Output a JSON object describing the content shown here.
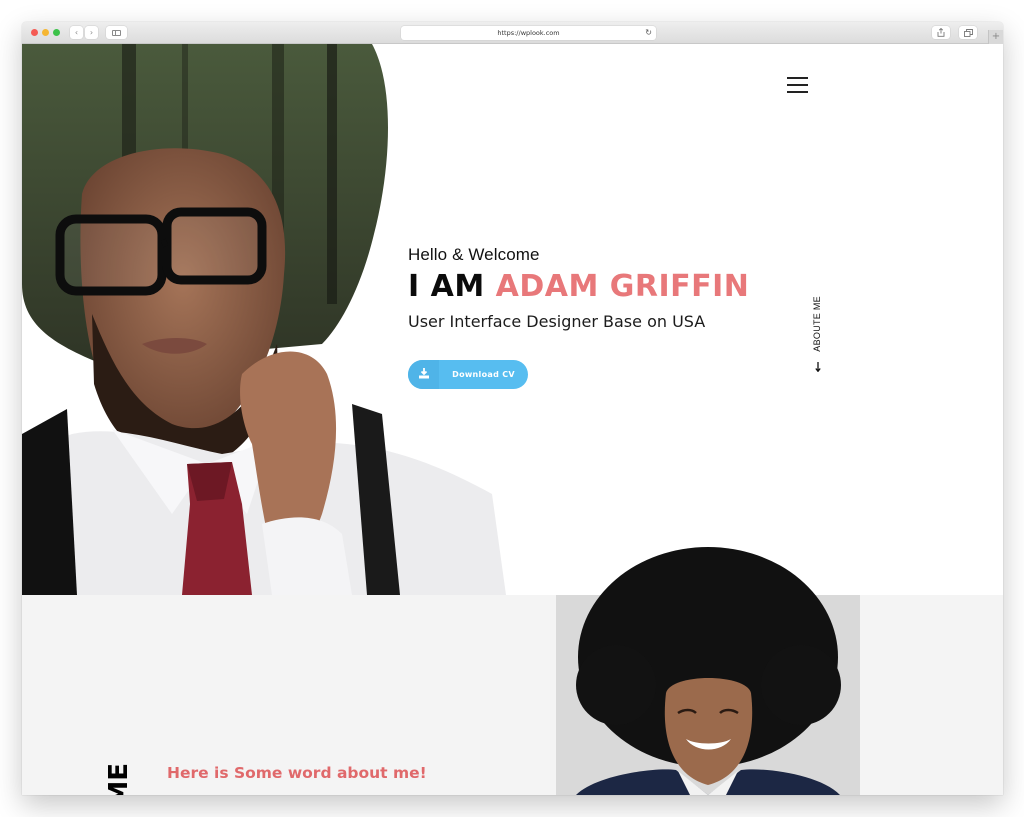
{
  "browser": {
    "url": "https://wplook.com",
    "back_icon": "‹",
    "forward_icon": "›",
    "reload_icon": "↻",
    "new_tab_icon": "+"
  },
  "hero": {
    "greeting": "Hello & Welcome",
    "headline_prefix": "I AM",
    "headline_name": "ADAM GRIFFIN",
    "tagline": "User Interface Designer Base on USA",
    "cv_button_label": "Download CV",
    "about_link_label": "ABOUTE ME",
    "about_link_arrow": "←",
    "photo_alt": "Portrait of man with glasses, suspenders and red tie"
  },
  "about": {
    "vertical_title": "ME",
    "heading": "Here is Some word about me!",
    "photo_alt": "Smiling man with afro hairstyle"
  },
  "colors": {
    "accent": "#e8787a",
    "button": "#57bdf0",
    "section_bg": "#f4f4f4"
  }
}
